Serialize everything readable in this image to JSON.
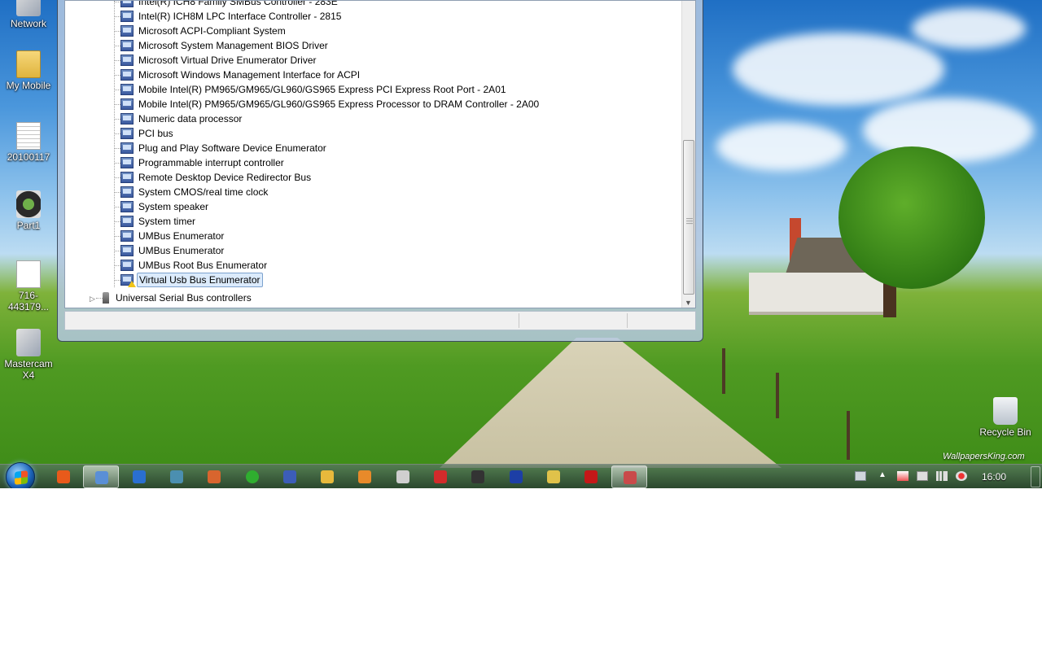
{
  "desktop": {
    "icons": [
      {
        "label": "Network"
      },
      {
        "label": "My Mobile"
      },
      {
        "label": "20100117"
      },
      {
        "label": "Part1"
      },
      {
        "label": "716-443179..."
      },
      {
        "label": "Mastercam X4"
      },
      {
        "label": "Recycle Bin"
      }
    ],
    "watermark": "WallpapersKing.com"
  },
  "device_manager": {
    "devices": [
      {
        "label": "Intel(R) ICH8 Family SMBus Controller - 283E"
      },
      {
        "label": "Intel(R) ICH8M LPC Interface Controller - 2815"
      },
      {
        "label": "Microsoft ACPI-Compliant System"
      },
      {
        "label": "Microsoft System Management BIOS Driver"
      },
      {
        "label": "Microsoft Virtual Drive Enumerator Driver"
      },
      {
        "label": "Microsoft Windows Management Interface for ACPI"
      },
      {
        "label": "Mobile Intel(R) PM965/GM965/GL960/GS965 Express PCI Express Root Port - 2A01"
      },
      {
        "label": "Mobile Intel(R) PM965/GM965/GL960/GS965 Express Processor to DRAM Controller - 2A00"
      },
      {
        "label": "Numeric data processor"
      },
      {
        "label": "PCI bus"
      },
      {
        "label": "Plug and Play Software Device Enumerator"
      },
      {
        "label": "Programmable interrupt controller"
      },
      {
        "label": "Remote Desktop Device Redirector Bus"
      },
      {
        "label": "System CMOS/real time clock"
      },
      {
        "label": "System speaker"
      },
      {
        "label": "System timer"
      },
      {
        "label": "UMBus Enumerator"
      },
      {
        "label": "UMBus Enumerator"
      },
      {
        "label": "UMBus Root Bus Enumerator"
      },
      {
        "label": "Virtual Usb Bus Enumerator",
        "selected": true,
        "warning": true
      }
    ],
    "category_usb": "Universal Serial Bus controllers"
  },
  "taskbar": {
    "pinned_icons": [
      "mail-icon",
      "device-manager-icon",
      "globe-icon",
      "settings-app-icon",
      "home-icon",
      "green-ball-icon",
      "speedometer-icon",
      "explorer-icon",
      "media-player-icon",
      "skull-icon",
      "acrobat-icon",
      "cad-icon",
      "bars-icon",
      "paint-icon",
      "grid-app-icon",
      "toolbox-icon"
    ],
    "active_index_1": 1,
    "active_index_2": 15,
    "clock": "16:00"
  }
}
